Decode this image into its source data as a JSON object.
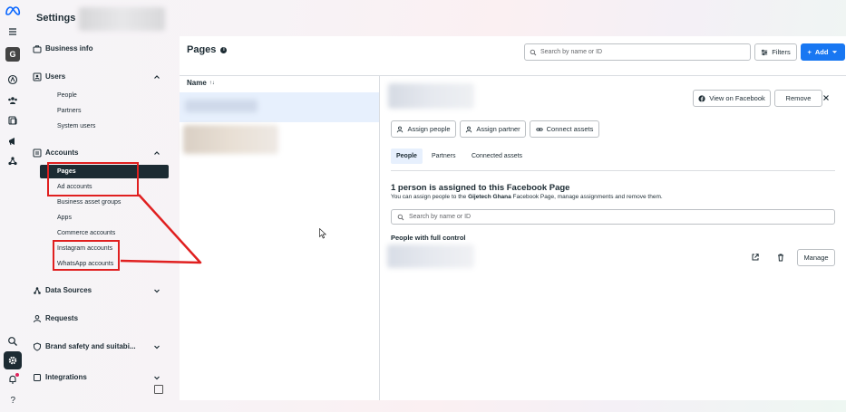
{
  "app": {
    "title": "Settings"
  },
  "rail": {
    "workspace_initial": "G",
    "icons": [
      "meta-logo",
      "menu-icon",
      "home-icon",
      "people-icon",
      "pages-icon",
      "ads-icon",
      "network-icon",
      "search-icon",
      "gear-icon",
      "bell-icon",
      "help-icon"
    ]
  },
  "sidebar": {
    "business_info": "Business info",
    "users": {
      "label": "Users",
      "items": [
        "People",
        "Partners",
        "System users"
      ]
    },
    "accounts": {
      "label": "Accounts",
      "items": [
        "Pages",
        "Ad accounts",
        "Business asset groups",
        "Apps",
        "Commerce accounts",
        "Instagram accounts",
        "WhatsApp accounts"
      ],
      "active": "Pages"
    },
    "data_sources": "Data Sources",
    "requests": "Requests",
    "brand_safety": "Brand safety and suitabi...",
    "integrations": "Integrations"
  },
  "main": {
    "title": "Pages",
    "search_placeholder": "Search by name or ID",
    "filters_label": "Filters",
    "add_label": "Add",
    "column_name": "Name",
    "sort_icon": "↑↓",
    "view_on_facebook": "View on Facebook",
    "remove_label": "Remove",
    "assign_people": "Assign people",
    "assign_partner": "Assign partner",
    "connect_assets": "Connect assets",
    "tabs": [
      "People",
      "Partners",
      "Connected assets"
    ],
    "active_tab": "People",
    "assigned_title": "1 person is assigned to this Facebook Page",
    "assigned_desc_prefix": "You can assign people to the ",
    "assigned_page_name": "Gijetech Ghana",
    "assigned_desc_suffix": " Facebook Page, manage assignments and remove them.",
    "people_search_placeholder": "Search by name or ID",
    "full_control_label": "People with full control",
    "manage_label": "Manage"
  },
  "colors": {
    "accent": "#1877f2",
    "annotation": "#e02020",
    "active_nav": "#1c2b33"
  }
}
